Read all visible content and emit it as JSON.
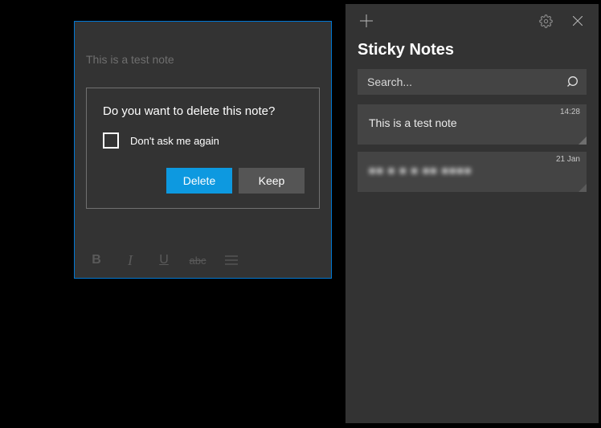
{
  "note": {
    "content": "This is a test note",
    "toolbar": {
      "b": "B",
      "i": "I",
      "u": "U",
      "s": "abc"
    }
  },
  "modal": {
    "title": "Do you want to delete this note?",
    "dont_ask": "Don't ask me again",
    "delete": "Delete",
    "keep": "Keep"
  },
  "sidebar": {
    "title": "Sticky Notes",
    "search_placeholder": "Search...",
    "notes": [
      {
        "time": "14:28",
        "text": "This is a test note"
      },
      {
        "time": "21 Jan",
        "text": "■■ ■ ■ ■  ■■ ■■■■"
      }
    ]
  }
}
